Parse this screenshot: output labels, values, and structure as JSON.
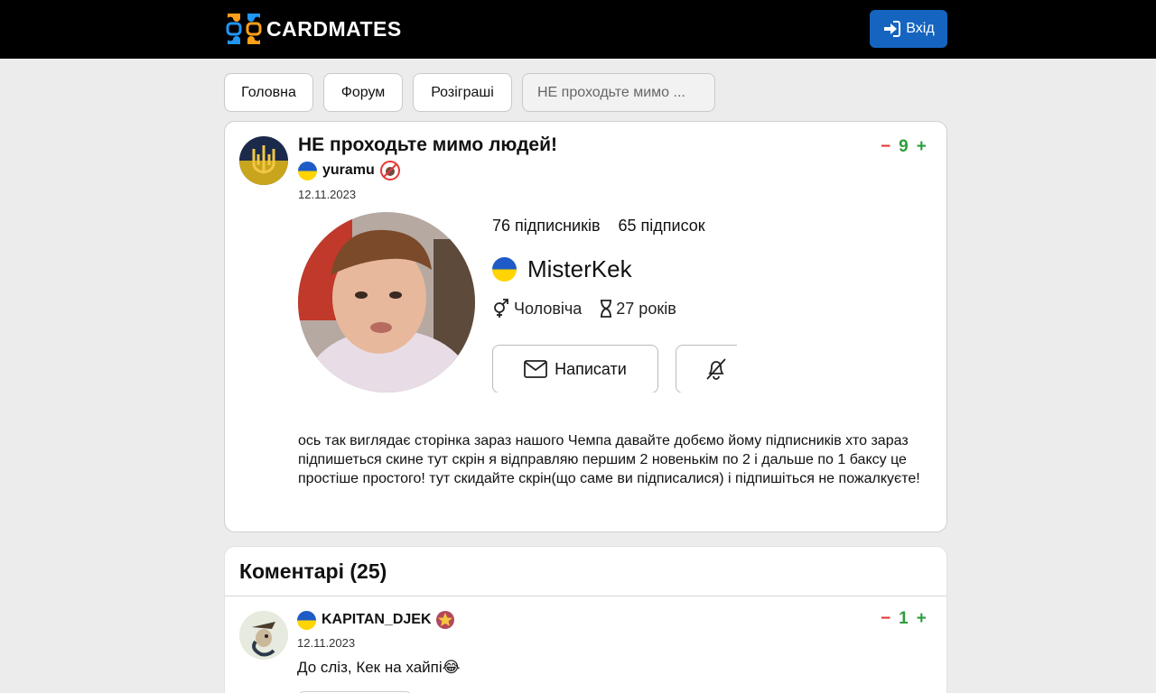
{
  "header": {
    "logo_text": "CARDMATES",
    "login_label": "Вхід"
  },
  "breadcrumbs": [
    "Головна",
    "Форум",
    "Розіграші",
    "НЕ проходьте мимо ..."
  ],
  "post": {
    "title": "НЕ проходьте мимо людей!",
    "author": "yuramu",
    "date": "12.11.2023",
    "rating": "9",
    "vote_minus": "−",
    "vote_plus": "+",
    "profile_embed": {
      "followers": "76 підписників",
      "following": "65 підписок",
      "name": "MisterKek",
      "gender": "Чоловіча",
      "age": "27 років",
      "write_button": "Написати"
    },
    "body": "ось так виглядає сторінка зараз  нашого Чемпа давайте добємо йому підписників хто зараз підпишеться скине тут скрін  я відправляю першим 2 новенькім по 2 і дальше по 1 баксу це простіше простого! тут скидайте скрін(що саме ви підписалися) і підпишіться не пожалкуєте!"
  },
  "comments": {
    "title": "Коментарі (25)",
    "items": [
      {
        "author": "KAPITAN_DJEK",
        "date": "12.11.2023",
        "text": "До сліз, Кек на хайпі😂",
        "rating": "1",
        "vote_minus": "−",
        "vote_plus": "+"
      }
    ]
  },
  "colors": {
    "topbar": "#000000",
    "login_button": "#1565c0",
    "vote_minus": "#e53935",
    "vote_plus": "#2e9e3a",
    "flag_blue": "#1e5bc6",
    "flag_yellow": "#ffd400"
  }
}
